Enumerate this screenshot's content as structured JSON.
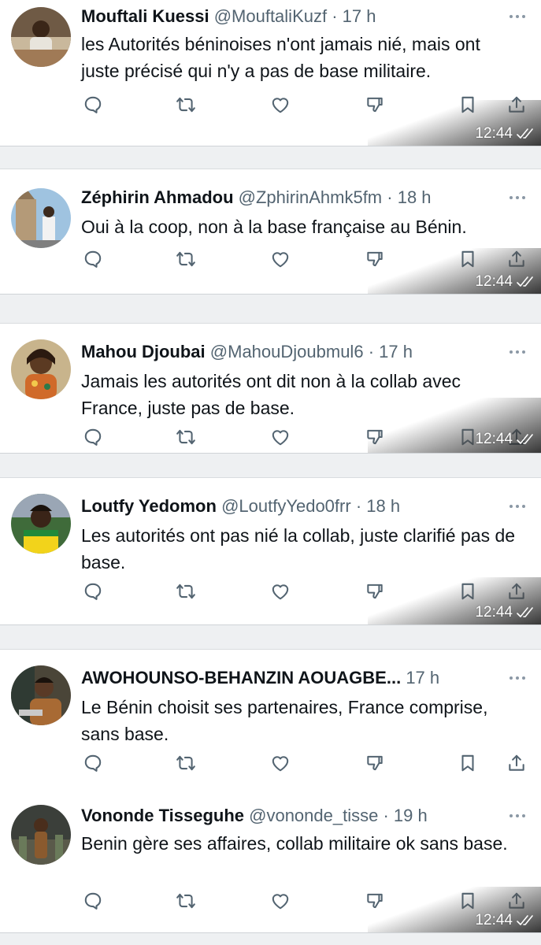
{
  "timestamp": "12:44",
  "tweets": [
    {
      "name": "Mouftali Kuessi",
      "handle": "@MouftaliKuzf",
      "time": "· 17 h",
      "text": "les Autorités béninoises n'ont jamais nié,  mais ont juste précisé qui n'y a pas de base militaire."
    },
    {
      "name": "Zéphirin Ahmadou",
      "handle": "@ZphirinAhmk5fm",
      "time": "· 18 h",
      "text": "Oui à la coop, non à la base française au Bénin."
    },
    {
      "name": "Mahou Djoubai",
      "handle": "@MahouDjoubmul6",
      "time": "· 17 h",
      "text": "Jamais les autorités ont dit non à la collab avec France, juste pas de base."
    },
    {
      "name": "Loutfy Yedomon",
      "handle": "@LoutfyYedo0frr",
      "time": "· 18 h",
      "text": "Les autorités ont pas nié la collab, juste clarifié pas de base."
    },
    {
      "name": "AWOHOUNSO-BEHANZIN AOUAGBE...",
      "handle": "",
      "time": "17 h",
      "text": "Le Bénin choisit ses partenaires, France comprise, sans base."
    },
    {
      "name": "Vononde Tisseguhe",
      "handle": "@vononde_tisse",
      "time": "· 19 h",
      "text": "Benin gère ses affaires, collab militaire ok sans base."
    }
  ],
  "icons": {
    "reply": "speech-bubble-icon",
    "retweet": "retweet-icon",
    "like": "heart-icon",
    "stats": "thumbs-down-icon",
    "bookmark": "bookmark-icon",
    "share": "share-icon",
    "more": "more-dots-icon",
    "read": "double-check-icon"
  }
}
